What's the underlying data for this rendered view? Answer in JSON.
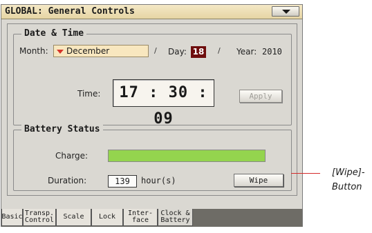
{
  "window": {
    "title": "GLOBAL: General Controls"
  },
  "date_time": {
    "legend": "Date & Time",
    "month_label": "Month:",
    "month_value": "December",
    "day_label": "Day:",
    "day_value": "18",
    "year_label": "Year:",
    "year_value": "2010",
    "separator": "/",
    "time_label": "Time:",
    "time_value": "17 : 30 : 09",
    "apply_label": "Apply"
  },
  "battery": {
    "legend": "Battery Status",
    "charge_label": "Charge:",
    "charge_level": 1.0,
    "charge_color": "#94d44e",
    "duration_label": "Duration:",
    "duration_value": "139",
    "duration_unit": "hour(s)",
    "wipe_label": "Wipe"
  },
  "tabs": [
    {
      "label": "Basic",
      "active": false
    },
    {
      "label": "Transp.\nControl",
      "active": false
    },
    {
      "label": "Scale",
      "active": false
    },
    {
      "label": "Lock",
      "active": false
    },
    {
      "label": "Inter-\nface",
      "active": false
    },
    {
      "label": "Clock &\nBattery",
      "active": true
    }
  ],
  "callout": {
    "text": "[Wipe]-\nButton",
    "color": "#d42a2a"
  }
}
